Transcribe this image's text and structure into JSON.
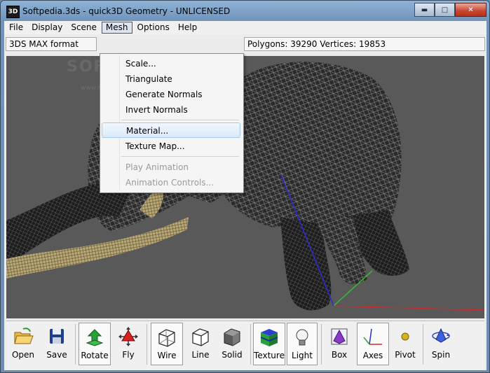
{
  "window": {
    "title": "Softpedia.3ds - quick3D Geometry - UNLICENSED",
    "icon_label": "3D",
    "controls": {
      "minimize": "minimize-icon",
      "maximize": "maximize-icon",
      "close": "close-icon"
    }
  },
  "menubar": {
    "items": [
      {
        "label": "File"
      },
      {
        "label": "Display"
      },
      {
        "label": "Scene"
      },
      {
        "label": "Mesh",
        "open": true
      },
      {
        "label": "Options"
      },
      {
        "label": "Help"
      }
    ]
  },
  "info": {
    "format": "3DS MAX format",
    "stats": "Polygons: 39290  Vertices: 19853"
  },
  "mesh_menu": {
    "items": [
      {
        "label": "Scale...",
        "enabled": true
      },
      {
        "label": "Triangulate",
        "enabled": true
      },
      {
        "label": "Generate Normals",
        "enabled": true
      },
      {
        "label": "Invert Normals",
        "enabled": true
      },
      {
        "label": "Material...",
        "enabled": true,
        "highlighted": true
      },
      {
        "label": "Texture Map...",
        "enabled": true
      },
      {
        "label": "Play Animation",
        "enabled": false
      },
      {
        "label": "Animation Controls...",
        "enabled": false
      }
    ]
  },
  "viewport": {
    "watermark": "SOFTPEDIA",
    "watermark_sub": "www.softpedia.com",
    "background": "#595959",
    "x_axis_color": "#d22a2a",
    "y_axis_color": "#2ec92e",
    "z_axis_color": "#2b2bd0"
  },
  "toolbar": {
    "buttons": [
      {
        "label": "Open",
        "icon": "folder-open-icon"
      },
      {
        "label": "Save",
        "icon": "floppy-disk-icon"
      },
      {
        "label": "Rotate",
        "icon": "rotate-icon",
        "pressed": true
      },
      {
        "label": "Fly",
        "icon": "fly-icon"
      },
      {
        "label": "Wire",
        "icon": "wire-cube-icon",
        "pressed": true
      },
      {
        "label": "Line",
        "icon": "line-cube-icon"
      },
      {
        "label": "Solid",
        "icon": "solid-cube-icon"
      },
      {
        "label": "Texture",
        "icon": "texture-cube-icon",
        "pressed": true
      },
      {
        "label": "Light",
        "icon": "light-bulb-icon",
        "pressed": true
      },
      {
        "label": "Box",
        "icon": "bounding-box-icon"
      },
      {
        "label": "Axes",
        "icon": "axes-icon",
        "pressed": true
      },
      {
        "label": "Pivot",
        "icon": "pivot-icon"
      },
      {
        "label": "Spin",
        "icon": "spin-icon"
      }
    ]
  }
}
